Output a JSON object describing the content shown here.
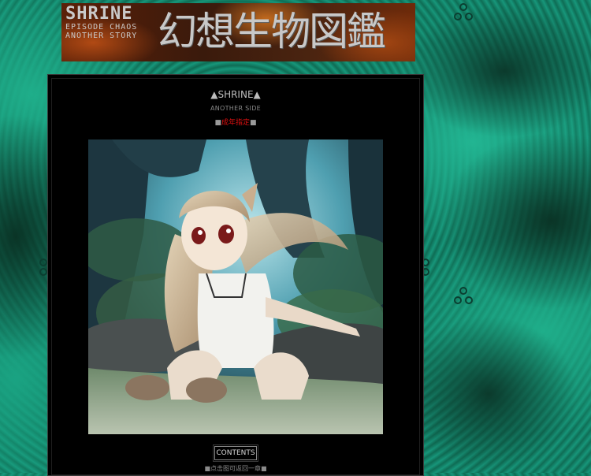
{
  "header": {
    "logo_line1": "SHRINE",
    "logo_line2": "EPISODE CHAOS",
    "logo_line3": "ANOTHER STORY",
    "japanese_title": "幻想生物図鑑"
  },
  "panel": {
    "title_marker": "▲",
    "title": "SHRINE",
    "subtitle": "ANOTHER SIDE",
    "warning_marker": "■",
    "warning_text": "成年指定",
    "contents_label": "CONTENTS",
    "footer_note": "■点击图可返回一章■"
  },
  "artwork": {
    "description_icon": "illustration-girl-in-forest"
  },
  "colors": {
    "background_teal": "#138a6d",
    "panel_bg": "#000000",
    "warning_red": "#e01010"
  }
}
